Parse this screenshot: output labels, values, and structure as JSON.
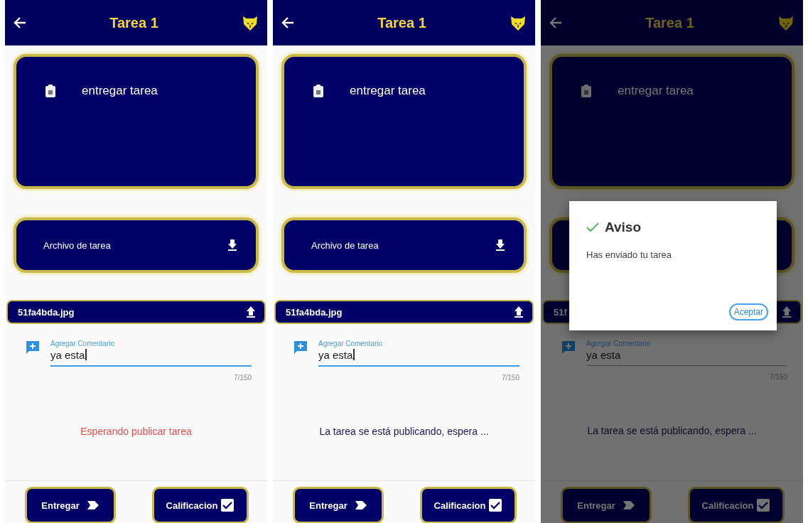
{
  "screens": [
    {
      "dimmed": false,
      "header": {
        "title": "Tarea 1"
      },
      "task_card": {
        "label": "entregar tarea"
      },
      "file_card": {
        "label": "Archivo de tarea"
      },
      "upload_bar": {
        "filename": "51fa4bda.jpg"
      },
      "comment": {
        "label": "Agregar Comentario",
        "value": "ya esta",
        "counter": "7/150",
        "focused": true
      },
      "status": {
        "kind": "waiting",
        "text": "Esperando publicar tarea"
      },
      "buttons": [
        {
          "kind": "submit",
          "label": "Entregar"
        },
        {
          "kind": "grade",
          "label": "Calificacion"
        }
      ]
    },
    {
      "dimmed": false,
      "header": {
        "title": "Tarea 1"
      },
      "task_card": {
        "label": "entregar tarea"
      },
      "file_card": {
        "label": "Archivo de tarea"
      },
      "upload_bar": {
        "filename": "51fa4bda.jpg"
      },
      "comment": {
        "label": "Agregar Comentario",
        "value": "ya esta",
        "counter": "7/150",
        "focused": true
      },
      "status": {
        "kind": "publishing",
        "text": "La tarea se está publicando, espera ..."
      },
      "buttons": [
        {
          "kind": "submit",
          "label": "Entregar"
        },
        {
          "kind": "grade",
          "label": "Calificacion"
        }
      ]
    },
    {
      "dimmed": true,
      "header": {
        "title": "Tarea 1"
      },
      "task_card": {
        "label": "entregar tarea"
      },
      "upload_bar": {
        "filename": "51f"
      },
      "comment": {
        "label": "Agregar Comentario",
        "value": "ya esta",
        "counter": "7/150",
        "focused": false
      },
      "status": {
        "kind": "publishing",
        "text": "La tarea se está publicando, espera ..."
      },
      "buttons": [
        {
          "kind": "submit",
          "label": "Entregar"
        },
        {
          "kind": "grade",
          "label": "Calificacion"
        }
      ],
      "dialog": {
        "title": "Aviso",
        "message": "Has enviado tu tarea",
        "button": "Aceptar"
      }
    }
  ]
}
